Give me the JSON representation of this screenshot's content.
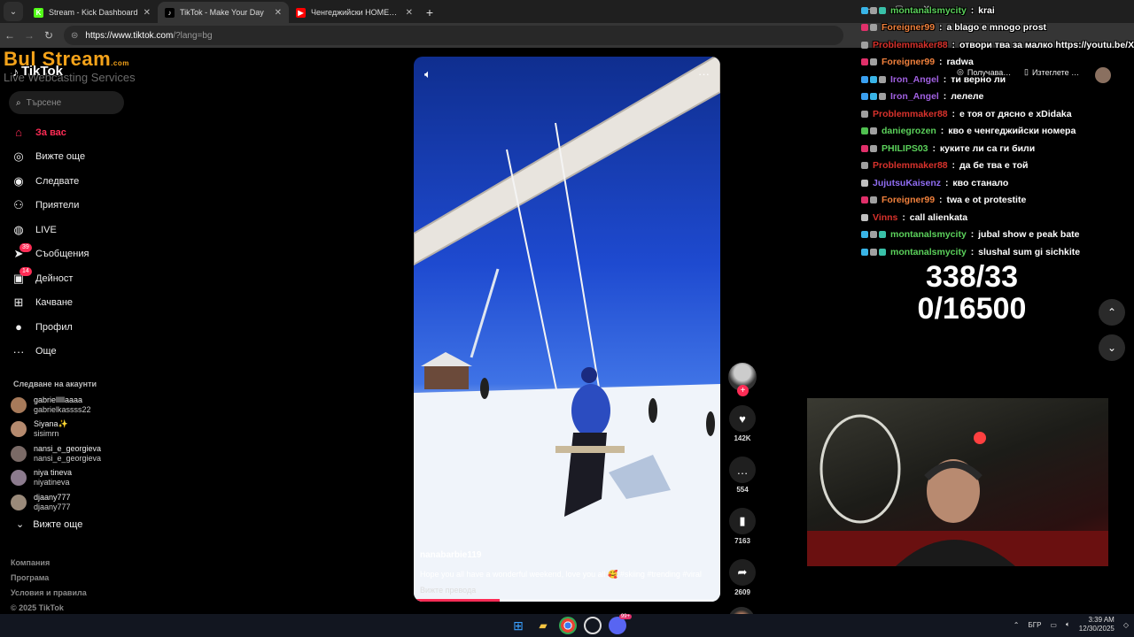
{
  "browser": {
    "tabs": [
      {
        "label": "Stream - Kick Dashboard",
        "fav": "K",
        "fav_color": "#53fc18",
        "active": false
      },
      {
        "label": "TikTok - Make Your Day",
        "fav": "♪",
        "fav_color": "#000000",
        "active": true
      },
      {
        "label": "Ченгеджийски НОМЕРА - You",
        "fav": "▶",
        "fav_color": "#ff0000",
        "active": false
      }
    ],
    "url_host": "https://www.tiktok.com",
    "url_path": "/?lang=bg"
  },
  "overlay_brand": {
    "name": "Bul Stream",
    "domain": ".com",
    "tagline": "Live Webcasting Services"
  },
  "tiktok": {
    "logo": "TikTok",
    "search_placeholder": "Търсене",
    "nav": [
      {
        "label": "За вас",
        "icon": "home-icon",
        "glyph": "⌂",
        "active": true
      },
      {
        "label": "Вижте още",
        "icon": "compass-icon",
        "glyph": "◎",
        "active": false
      },
      {
        "label": "Следвате",
        "icon": "following-icon",
        "glyph": "◉",
        "active": false
      },
      {
        "label": "Приятели",
        "icon": "friends-icon",
        "glyph": "⚇",
        "active": false
      },
      {
        "label": "LIVE",
        "icon": "live-icon",
        "glyph": "◍",
        "active": false
      },
      {
        "label": "Съобщения",
        "icon": "messages-icon",
        "glyph": "➤",
        "badge": "39",
        "active": false
      },
      {
        "label": "Дейност",
        "icon": "activity-icon",
        "glyph": "▣",
        "badge": "14",
        "active": false
      },
      {
        "label": "Качване",
        "icon": "upload-icon",
        "glyph": "⊞",
        "active": false
      },
      {
        "label": "Профил",
        "icon": "profile-icon",
        "glyph": "●",
        "active": false
      },
      {
        "label": "Още",
        "icon": "more-icon",
        "glyph": "···",
        "active": false
      }
    ],
    "following_title": "Следване на акаунти",
    "accounts": [
      {
        "name": "gabrielllllaaaa",
        "user": "gabrielkassss22",
        "color": "#a77a5a"
      },
      {
        "name": "Siyana✨",
        "user": "sisimrn",
        "color": "#b58a6e"
      },
      {
        "name": "nansi_e_georgieva",
        "user": "nansi_e_georgieva",
        "color": "#7a6a66"
      },
      {
        "name": "niya tineva",
        "user": "niyatineva",
        "color": "#8c7b8e"
      },
      {
        "name": "djaany777",
        "user": "djaany777",
        "color": "#9a8a7a"
      }
    ],
    "see_more": "Вижте още",
    "footer": [
      "Компания",
      "Програма",
      "Условия и правила",
      "© 2025 TikTok"
    ],
    "header_buttons": [
      "Получава…",
      "Изтеглете …"
    ],
    "video": {
      "username": "nanabarbie119",
      "description": "Hope you all have a wonderful weekend, love you all 🥰 #skiing #trending #viral",
      "translate": "Вижте превода",
      "progress": 0.28,
      "likes": "142K",
      "comments": "554",
      "saves": "7163",
      "shares": "2609"
    }
  },
  "chat": [
    {
      "user": "montanalsmycity",
      "text": "krai",
      "color": "#5bd15b",
      "badges": [
        "#39b4e6",
        "#a0a0a0",
        "#39c0a8"
      ]
    },
    {
      "user": "Foreigner99",
      "text": "a blago e mnogo prost",
      "color": "#f0803c",
      "badges": [
        "#e0306a",
        "#a0a0a0"
      ]
    },
    {
      "user": "Problemmaker88",
      "text": "отвори тва за малко https://youtu.be/XrY",
      "color": "#d8322c",
      "badges": [
        "#a0a0a0"
      ]
    },
    {
      "user": "Foreigner99",
      "text": "radwa",
      "color": "#f0803c",
      "badges": [
        "#e0306a",
        "#a0a0a0"
      ]
    },
    {
      "user": "Iron_Angel",
      "text": "ти верно ли",
      "color": "#a060e0",
      "badges": [
        "#3aa0f0",
        "#39b4e6",
        "#a0a0a0"
      ]
    },
    {
      "user": "Iron_Angel",
      "text": "лелеле",
      "color": "#a060e0",
      "badges": [
        "#3aa0f0",
        "#39b4e6",
        "#a0a0a0"
      ]
    },
    {
      "user": "Problemmaker88",
      "text": "е тоя от дясно е xDidaka",
      "color": "#d8322c",
      "badges": [
        "#a0a0a0"
      ]
    },
    {
      "user": "daniegrozen",
      "text": "кво е ченгеджийски номера",
      "color": "#5bd15b",
      "badges": [
        "#50c050",
        "#a0a0a0"
      ]
    },
    {
      "user": "PHILIPS03",
      "text": "куките ли са ги били",
      "color": "#5bd15b",
      "badges": [
        "#e0306a",
        "#a0a0a0"
      ]
    },
    {
      "user": "Problemmaker88",
      "text": "да бе тва е той",
      "color": "#d8322c",
      "badges": [
        "#a0a0a0"
      ]
    },
    {
      "user": "JujutsuKaisenz",
      "text": "кво станало",
      "color": "#8f6cf0",
      "badges": [
        "#c0c0c0"
      ]
    },
    {
      "user": "Foreigner99",
      "text": "twa e ot protestite",
      "color": "#f0803c",
      "badges": [
        "#e0306a",
        "#a0a0a0"
      ]
    },
    {
      "user": "Vinns",
      "text": "call alienkata",
      "color": "#d8322c",
      "badges": [
        "#c0c0c0"
      ]
    },
    {
      "user": "montanalsmycity",
      "text": "jubal show e peak bate",
      "color": "#5bd15b",
      "badges": [
        "#39b4e6",
        "#a0a0a0",
        "#39c0a8"
      ]
    },
    {
      "user": "montanalsmycity",
      "text": "slushal sum gi sichkite",
      "color": "#5bd15b",
      "badges": [
        "#39b4e6",
        "#a0a0a0",
        "#39c0a8"
      ]
    }
  ],
  "counters": {
    "line1": "338/33",
    "line2": "0/16500"
  },
  "taskbar": {
    "lang": "БГР",
    "time": "3:39 AM",
    "date": "12/30/2025",
    "discord_badge": "99+"
  }
}
